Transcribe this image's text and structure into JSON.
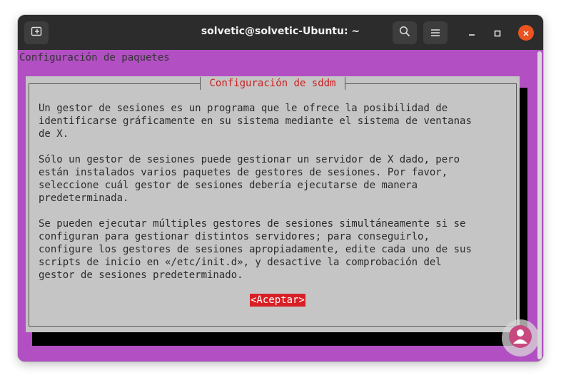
{
  "window": {
    "title": "solvetic@solvetic-Ubuntu: ~"
  },
  "titlebar": {
    "new_tab_icon": "new-tab-icon",
    "search_icon": "search-icon",
    "menu_icon": "hamburger-menu-icon",
    "minimize_icon": "minimize-icon",
    "maximize_icon": "maximize-icon",
    "close_icon": "close-icon"
  },
  "terminal": {
    "header": "Configuración de paquetes"
  },
  "dialog": {
    "title": "Configuración de sddm",
    "body": "Un gestor de sesiones es un programa que le ofrece la posibilidad de\nidentificarse gráficamente en su sistema mediante el sistema de ventanas\nde X.\n\nSólo un gestor de sesiones puede gestionar un servidor de X dado, pero\nestán instalados varios paquetes de gestores de sesiones. Por favor,\nseleccione cuál gestor de sesiones debería ejecutarse de manera\npredeterminada.\n\nSe pueden ejecutar múltiples gestores de sesiones simultáneamente si se\nconfiguran para gestionar distintos servidores; para conseguirlo,\nconfigure los gestores de sesiones apropiadamente, edite cada uno de sus\nscripts de inicio en «/etc/init.d», y desactive la comprobación del\ngestor de sesiones predeterminado.",
    "accept_label": "<Aceptar>"
  },
  "colors": {
    "terminal_bg": "#b24fc3",
    "dialog_bg": "#c5c5c5",
    "title_red": "#cc1f1f",
    "button_red": "#d81f26",
    "close_orange": "#e95420"
  }
}
